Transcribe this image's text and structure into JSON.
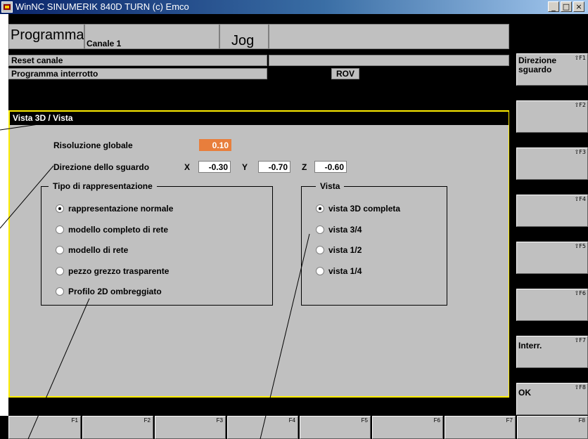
{
  "window": {
    "title": "WinNC SINUMERIK 840D TURN (c) Emco",
    "buttons": [
      "_",
      "□",
      "×"
    ]
  },
  "header": {
    "area": "Programma",
    "channel": "Canale 1",
    "mode": "Jog",
    "status1": "Reset canale",
    "status2": "Programma interrotto",
    "rov": "ROV"
  },
  "dialog": {
    "title": "Vista 3D / Vista",
    "resolution_label": "Risoluzione globale",
    "resolution_value": "0.10",
    "direction_label": "Direzione dello sguardo",
    "x_label": "X",
    "x_value": "-0.30",
    "y_label": "Y",
    "y_value": "-0.70",
    "z_label": "Z",
    "z_value": "-0.60",
    "rep_group": {
      "title": "Tipo di rappresentazione",
      "options": [
        {
          "label": "rappresentazione normale",
          "selected": true
        },
        {
          "label": "modello completo di rete",
          "selected": false
        },
        {
          "label": "modello di rete",
          "selected": false
        },
        {
          "label": "pezzo grezzo trasparente",
          "selected": false
        },
        {
          "label": "Profilo 2D ombreggiato",
          "selected": false
        }
      ]
    },
    "view_group": {
      "title": "Vista",
      "options": [
        {
          "label": "vista 3D completa",
          "selected": true
        },
        {
          "label": "vista 3/4",
          "selected": false
        },
        {
          "label": "vista 1/2",
          "selected": false
        },
        {
          "label": "vista 1/4",
          "selected": false
        }
      ]
    }
  },
  "softkeys_right": [
    {
      "label": "Direzione sguardo",
      "fkey": "⇧F1"
    },
    {
      "label": "",
      "fkey": "⇧F2"
    },
    {
      "label": "",
      "fkey": "⇧F3"
    },
    {
      "label": "",
      "fkey": "⇧F4"
    },
    {
      "label": "",
      "fkey": "⇧F5"
    },
    {
      "label": "",
      "fkey": "⇧F6"
    },
    {
      "label": "Interr.",
      "fkey": "⇧F7"
    },
    {
      "label": "OK",
      "fkey": "⇧F8"
    }
  ],
  "softkeys_bottom": [
    "F1",
    "F2",
    "F3",
    "F4",
    "F5",
    "F6",
    "F7",
    "F8"
  ],
  "colors": {
    "title_bar": "#0a246a",
    "panel": "#c0c0c0",
    "dialog_border": "#ffee00",
    "highlight": "#e87e3c"
  }
}
